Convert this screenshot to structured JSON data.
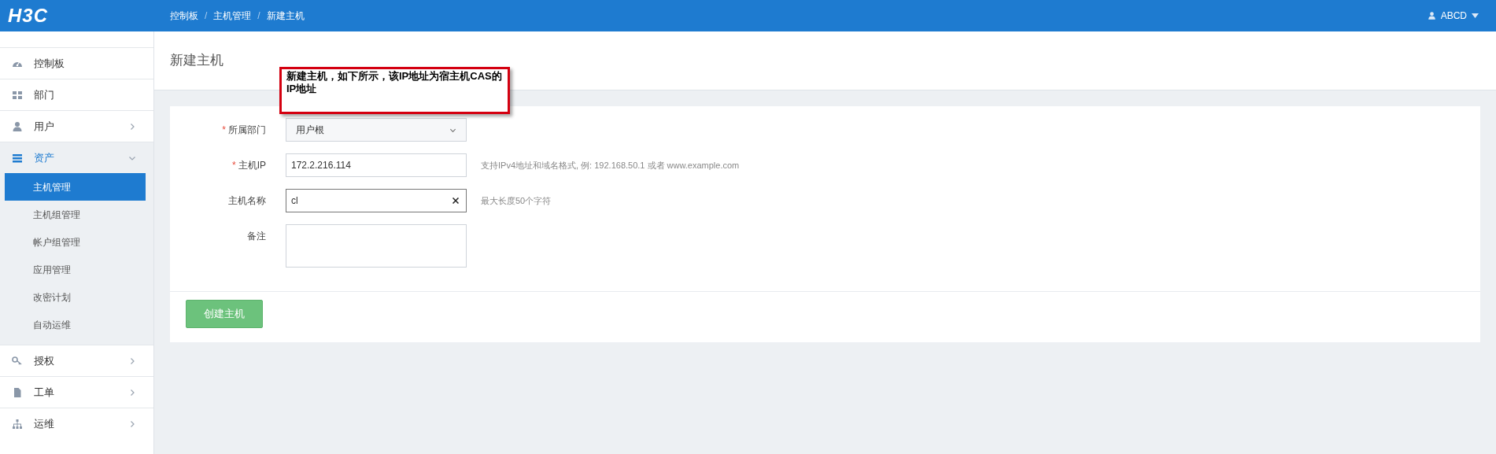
{
  "header": {
    "logo": "H3C",
    "breadcrumb": [
      "控制板",
      "主机管理",
      "新建主机"
    ],
    "breadcrumb_separator": "/",
    "user": "ABCD"
  },
  "sidebar": {
    "items": [
      {
        "label": "控制板",
        "kind": "gauge"
      },
      {
        "label": "部门",
        "kind": "grid"
      },
      {
        "label": "用户",
        "kind": "user",
        "expanded": false
      },
      {
        "label": "资产",
        "kind": "list",
        "expanded": true,
        "children": [
          {
            "label": "主机管理",
            "selected": true
          },
          {
            "label": "主机组管理",
            "selected": false
          },
          {
            "label": "帐户组管理",
            "selected": false
          },
          {
            "label": "应用管理",
            "selected": false
          },
          {
            "label": "改密计划",
            "selected": false
          },
          {
            "label": "自动运维",
            "selected": false
          }
        ]
      },
      {
        "label": "授权",
        "kind": "key",
        "expanded": false
      },
      {
        "label": "工单",
        "kind": "file",
        "expanded": false
      },
      {
        "label": "运维",
        "kind": "tree",
        "expanded": false
      }
    ]
  },
  "page": {
    "title": "新建主机",
    "annotation": "新建主机，如下所示，该IP地址为宿主机CAS的IP地址",
    "form": {
      "fields": [
        {
          "kind": "select",
          "label": "所属部门",
          "required_mark": "*",
          "value": "用户根"
        },
        {
          "kind": "text",
          "label": "主机IP",
          "required_mark": "*",
          "value": "172.2.216.114",
          "hint": "支持IPv4地址和域名格式, 例: 192.168.50.1 或者 www.example.com",
          "focused": false
        },
        {
          "kind": "text",
          "label": "主机名称",
          "value": "cl",
          "hint": "最大长度50个字符",
          "focused": true,
          "clearable": true
        },
        {
          "kind": "textarea",
          "label": "备注"
        }
      ]
    },
    "submit": "创建主机"
  }
}
